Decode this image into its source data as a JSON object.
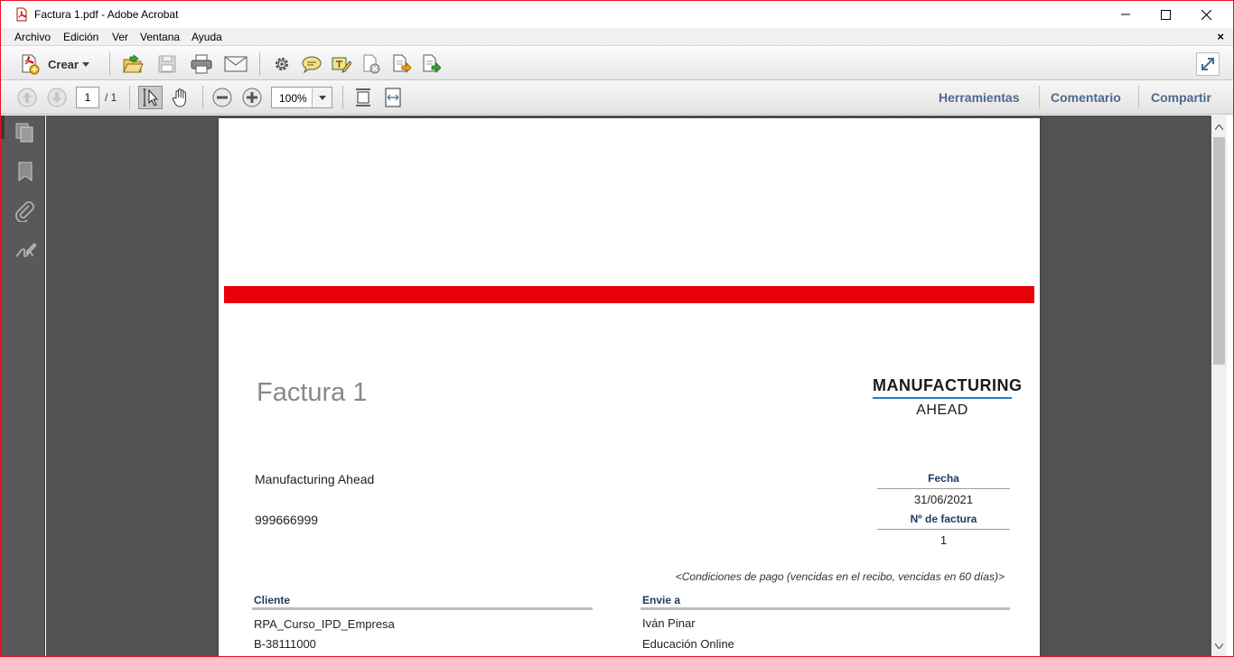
{
  "window": {
    "title": "Factura 1.pdf - Adobe Acrobat"
  },
  "menu": [
    "Archivo",
    "Edición",
    "Ver",
    "Ventana",
    "Ayuda"
  ],
  "menu_close": "×",
  "toolbar": {
    "create_label": "Crear",
    "icons": [
      "open-folder-icon",
      "save-icon",
      "print-icon",
      "email-icon",
      "settings-gear-icon",
      "comment-bubble-icon",
      "highlight-pen-icon",
      "delete-comment-icon",
      "export-document-icon",
      "share-document-icon"
    ]
  },
  "navigation": {
    "current_page": "1",
    "total_pages": "/ 1",
    "zoom": "100%"
  },
  "right_panel_links": [
    "Herramientas",
    "Comentario",
    "Compartir"
  ],
  "document": {
    "title": "Factura 1",
    "logo_top": "MANUFACTURING",
    "logo_bottom": "AHEAD",
    "company_name": "Manufacturing Ahead",
    "company_phone": "999666999",
    "date_label": "Fecha",
    "date_value": "31/06/2021",
    "invoice_no_label": "Nº de factura",
    "invoice_no_value": "1",
    "payment_terms": "<Condiciones de pago (vencidas en el recibo, vencidas en 60 días)>",
    "client_label": "Cliente",
    "client_lines": [
      "RPA_Curso_IPD_Empresa",
      "B-38111000"
    ],
    "ship_label": "Envie a",
    "ship_lines": [
      "Iván Pinar",
      "Educación Online"
    ]
  },
  "colors": {
    "accent_red": "#e8000a",
    "link_blue": "#4b6a8c",
    "header_navy": "#1e3b63",
    "logo_blue": "#2b7fc1"
  }
}
